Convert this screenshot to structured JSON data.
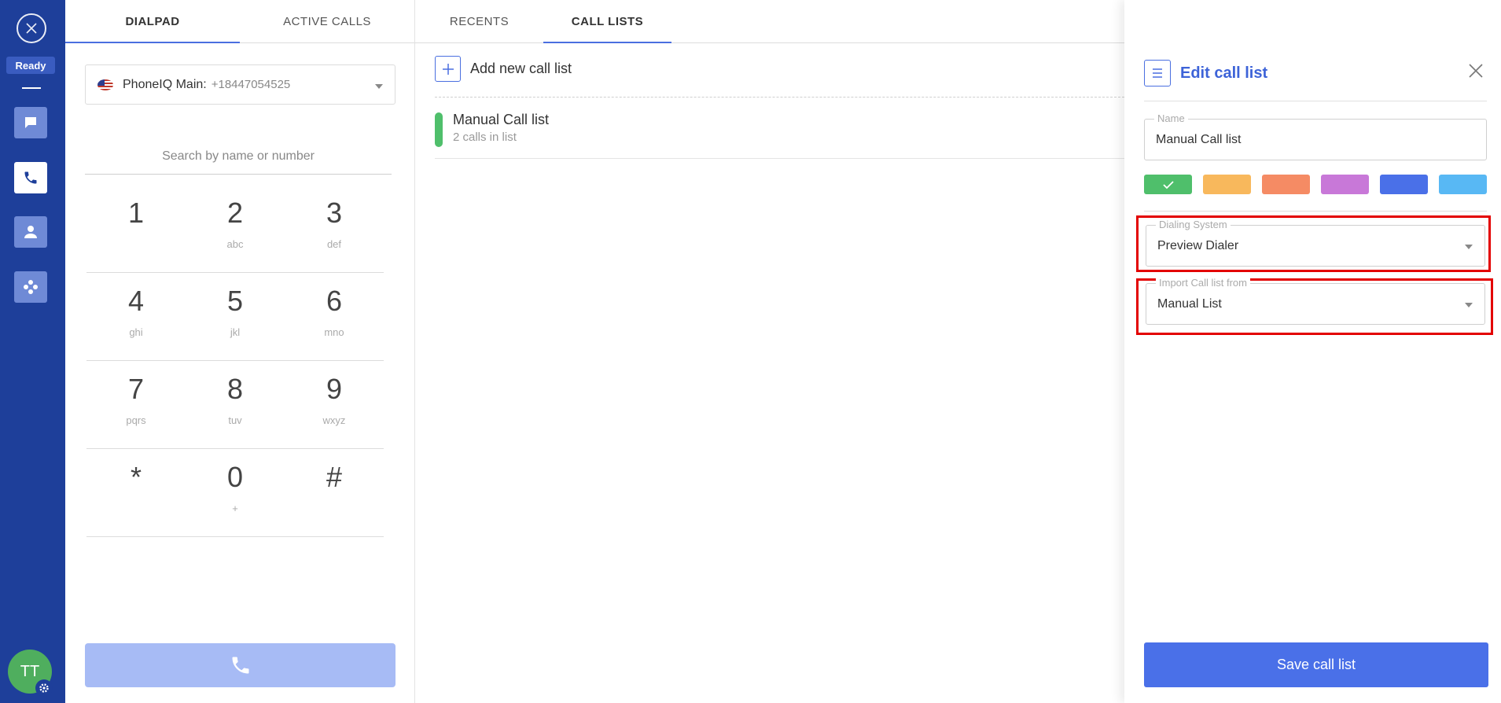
{
  "rail": {
    "status": "Ready",
    "avatar_initials": "TT"
  },
  "dialpad_tabs": [
    "DIALPAD",
    "ACTIVE CALLS"
  ],
  "phone_line": {
    "name": "PhoneIQ Main:",
    "number": "+18447054525"
  },
  "search": {
    "placeholder": "Search by name or number"
  },
  "keypad": [
    [
      {
        "d": "1",
        "l": ""
      },
      {
        "d": "2",
        "l": "abc"
      },
      {
        "d": "3",
        "l": "def"
      }
    ],
    [
      {
        "d": "4",
        "l": "ghi"
      },
      {
        "d": "5",
        "l": "jkl"
      },
      {
        "d": "6",
        "l": "mno"
      }
    ],
    [
      {
        "d": "7",
        "l": "pqrs"
      },
      {
        "d": "8",
        "l": "tuv"
      },
      {
        "d": "9",
        "l": "wxyz"
      }
    ],
    [
      {
        "d": "*",
        "l": ""
      },
      {
        "d": "0",
        "l": "+"
      },
      {
        "d": "#",
        "l": ""
      }
    ]
  ],
  "list_tabs": [
    "RECENTS",
    "CALL LISTS"
  ],
  "add_list_label": "Add new call list",
  "call_lists": [
    {
      "name": "Manual Call list",
      "sub": "2 calls in list",
      "color": "#4fbf6b"
    }
  ],
  "edit_panel": {
    "title": "Edit call list",
    "name_label": "Name",
    "name_value": "Manual Call list",
    "colors": [
      "#4fbf6b",
      "#f8b85c",
      "#f58b64",
      "#c878d8",
      "#4a70e8",
      "#58b8f4"
    ],
    "dialing_label": "Dialing System",
    "dialing_value": "Preview Dialer",
    "import_label": "Import Call list from",
    "import_value": "Manual List",
    "save_label": "Save call list"
  }
}
